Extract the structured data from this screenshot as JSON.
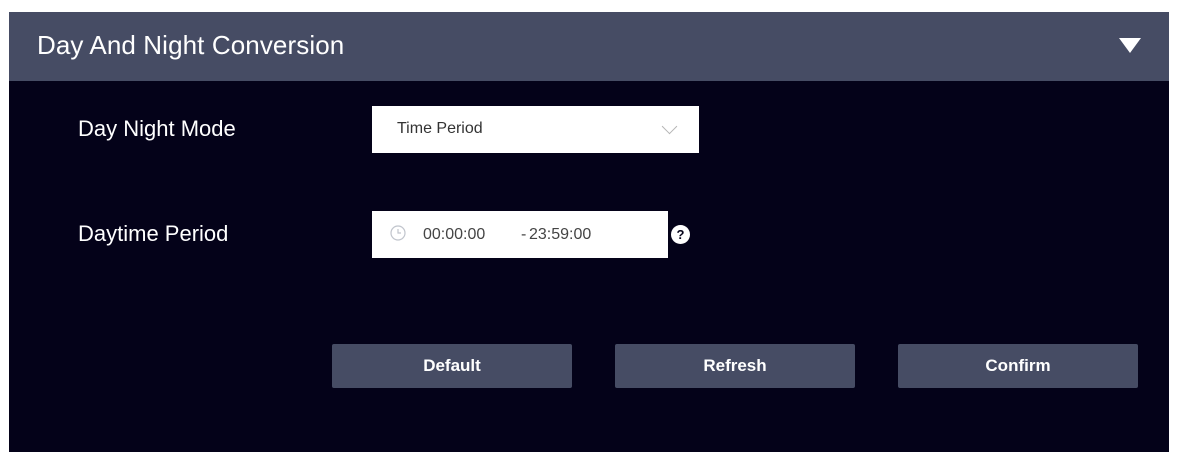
{
  "panel": {
    "title": "Day And Night Conversion",
    "collapse_icon": "caret-down-icon"
  },
  "fields": {
    "day_night_mode": {
      "label": "Day Night Mode",
      "value": "Time Period"
    },
    "daytime_period": {
      "label": "Daytime Period",
      "start": "00:00:00",
      "separator": "-",
      "end": "23:59:00",
      "help": "?"
    }
  },
  "buttons": {
    "default_label": "Default",
    "refresh_label": "Refresh",
    "confirm_label": "Confirm"
  },
  "colors": {
    "panel_background": "#040219",
    "header_background": "#464c64",
    "button_background": "#464c64",
    "text": "#ffffff"
  }
}
